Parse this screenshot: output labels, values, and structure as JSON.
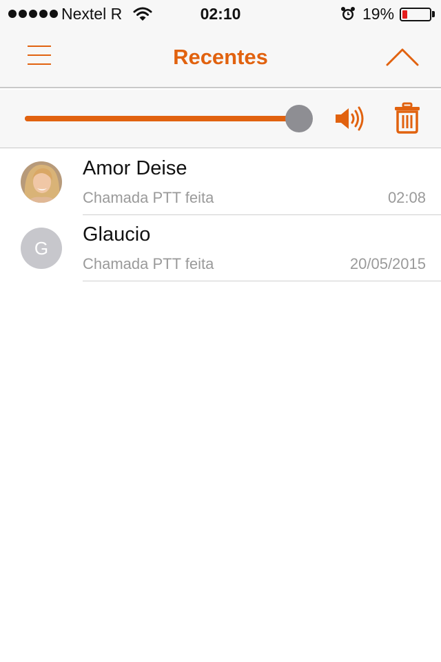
{
  "status_bar": {
    "carrier": "Nextel R",
    "time": "02:10",
    "battery_percent": "19%",
    "battery_level": 0.19,
    "signal_bars": 5
  },
  "header": {
    "title": "Recentes"
  },
  "volume": {
    "level": 1.0
  },
  "recents": [
    {
      "name": "Amor Deise",
      "subtitle": "Chamada PTT feita",
      "time": "02:08",
      "avatar": "photo"
    },
    {
      "name": "Glaucio",
      "subtitle": "Chamada PTT feita",
      "time": "20/05/2015",
      "avatar_initial": "G"
    }
  ],
  "colors": {
    "accent": "#e1620f",
    "thumb": "#8e8e93",
    "battery_low": "#e41d1d"
  }
}
